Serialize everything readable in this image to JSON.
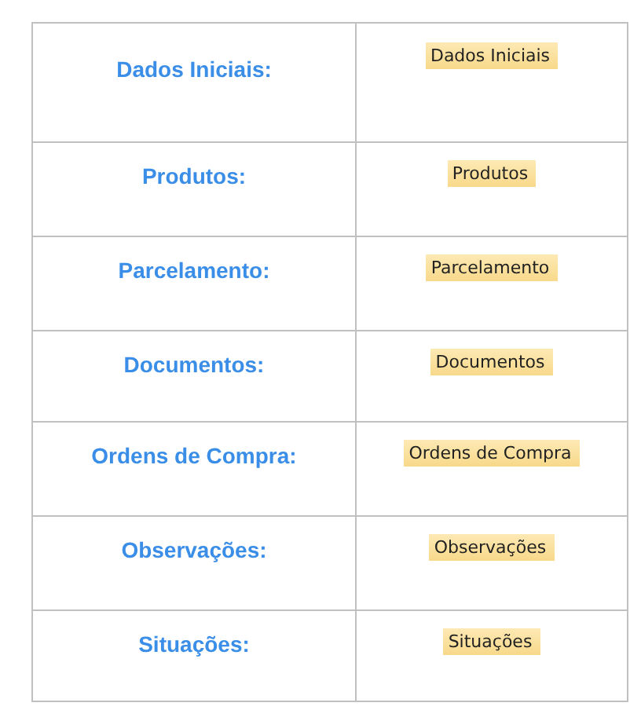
{
  "rows": [
    {
      "label": "Dados Iniciais:",
      "button": "Dados Iniciais"
    },
    {
      "label": "Produtos:",
      "button": "Produtos"
    },
    {
      "label": "Parcelamento:",
      "button": "Parcelamento"
    },
    {
      "label": "Documentos:",
      "button": "Documentos"
    },
    {
      "label": "Ordens de Compra:",
      "button": "Ordens de Compra"
    },
    {
      "label": "Observações:",
      "button": "Observações"
    },
    {
      "label": "Situações:",
      "button": "Situações"
    }
  ]
}
